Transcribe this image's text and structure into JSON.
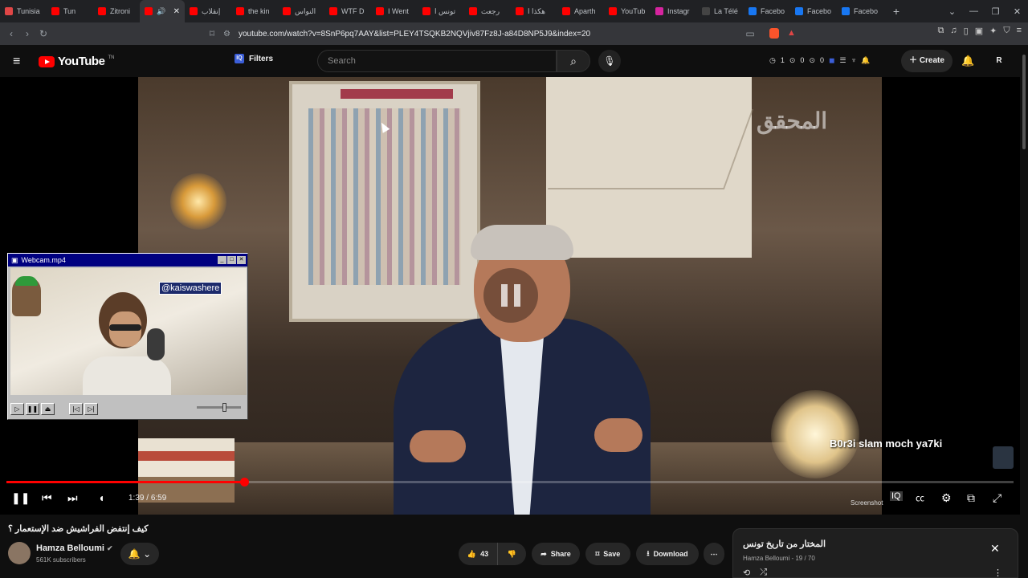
{
  "browser": {
    "tabs": [
      {
        "label": "Tunisia",
        "color": "#e04646",
        "active": false
      },
      {
        "label": "Tun",
        "color": "#ff0000",
        "active": false
      },
      {
        "label": "Zitroni",
        "color": "#ff0000",
        "active": false
      },
      {
        "label": "",
        "color": "#ff0000",
        "active": true
      },
      {
        "label": "إنقلاب",
        "color": "#ff0000",
        "active": false
      },
      {
        "label": "the kin",
        "color": "#ff0000",
        "active": false
      },
      {
        "label": "النواس",
        "color": "#ff0000",
        "active": false
      },
      {
        "label": "WTF D",
        "color": "#ff0000",
        "active": false
      },
      {
        "label": "I Went",
        "color": "#ff0000",
        "active": false
      },
      {
        "label": "تونس ا",
        "color": "#ff0000",
        "active": false
      },
      {
        "label": "رجعت",
        "color": "#ff0000",
        "active": false
      },
      {
        "label": "هكذا ا",
        "color": "#ff0000",
        "active": false
      },
      {
        "label": "Aparth",
        "color": "#ff0000",
        "active": false
      },
      {
        "label": "YouTub",
        "color": "#ff0000",
        "active": false
      },
      {
        "label": "Instagr",
        "color": "#d6249f",
        "active": false
      },
      {
        "label": "La Télé",
        "color": "#444444",
        "active": false
      },
      {
        "label": "Facebo",
        "color": "#1877f2",
        "active": false
      },
      {
        "label": "Facebo",
        "color": "#1877f2",
        "active": false
      },
      {
        "label": "Facebo",
        "color": "#1877f2",
        "active": false
      }
    ],
    "url": "youtube.com/watch?v=8SnP6pq7AAY&list=PLEY4TSQKB2NQVjiv87Fz8J-a84D8NP5J9&index=20"
  },
  "masthead": {
    "logo_text": "YouTube",
    "logo_suffix": "TN",
    "filters_label": "Filters",
    "search_placeholder": "Search",
    "stat1": "1",
    "stat2": "0",
    "stat3": "0",
    "create_label": "Create",
    "avatar_letter": "R"
  },
  "player": {
    "watermark": "المحقق",
    "overlay_text": "B0r3i slam moch ya7ki",
    "time_current": "1:39",
    "time_separator": "/",
    "time_total": "6:59",
    "progress_fraction": 0.236,
    "screenshot_label": "Screenshot"
  },
  "webcam": {
    "title": "Webcam.mp4",
    "tag": "@kaiswashere"
  },
  "video": {
    "title": "كيف إنتفض الفراشيش ضد الإستعمار ؟",
    "channel": "Hamza Belloumi",
    "subscribers": "561K subscribers",
    "likes": "43",
    "share_label": "Share",
    "save_label": "Save",
    "download_label": "Download"
  },
  "playlist": {
    "title": "المختار من تاريخ تونس",
    "owner": "Hamza Belloumi",
    "position": "19 / 70"
  }
}
